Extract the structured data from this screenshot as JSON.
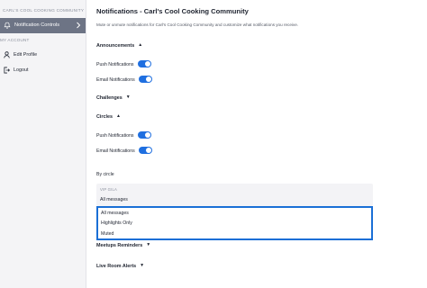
{
  "sidebar": {
    "community_name": "CARL'S COOL COOKING COMMUNITY",
    "active_item": {
      "label": "Notification Controls",
      "icon": "bell-icon"
    },
    "section_label": "MY ACCOUNT",
    "items": [
      {
        "label": "Edit Profile",
        "icon": "user-icon"
      },
      {
        "label": "Logout",
        "icon": "logout-icon"
      }
    ]
  },
  "main": {
    "title": "Notifications - Carl's Cool Cooking Community",
    "description": "Mute or unmute notifications for Carl's Cool Cooking Community and customize what notifications you receive.",
    "announcements": {
      "label": "Announcements",
      "expanded": true,
      "push_label": "Push Notifications",
      "push_on": true,
      "email_label": "Email Notifications",
      "email_on": true
    },
    "challenges": {
      "label": "Challenges",
      "expanded": false
    },
    "circles": {
      "label": "Circles",
      "expanded": true,
      "push_label": "Push Notifications",
      "push_on": true,
      "email_label": "Email Notifications",
      "email_on": true
    },
    "by_circle": {
      "label": "By circle",
      "group_label": "VIP GILA",
      "selected_value": "All messages",
      "options": [
        "All messages",
        "Highlights Only",
        "Muted"
      ]
    },
    "meetups_reminders": {
      "label": "Meetups Reminders",
      "expanded": false
    },
    "live_room_alerts": {
      "label": "Live Room Alerts",
      "expanded": false
    }
  },
  "colors": {
    "accent": "#1f6fe0",
    "sidebar_active": "#6d7485",
    "dropdown_border": "#1a6fd6"
  }
}
